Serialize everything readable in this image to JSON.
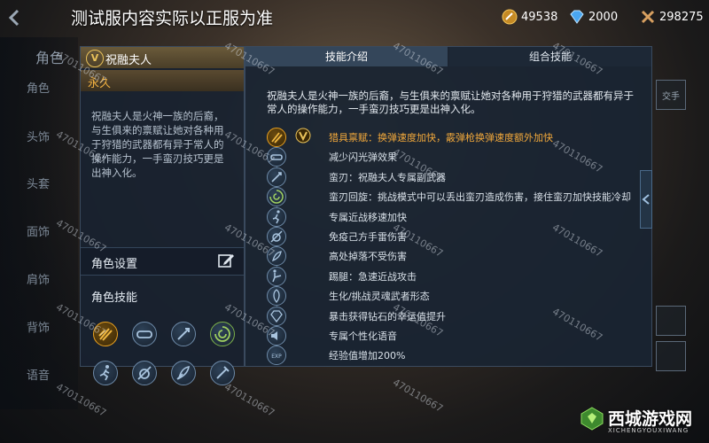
{
  "header": {
    "back_icon": "chevron-left-icon",
    "title": "测试服内容实际以正服为准",
    "currencies": [
      {
        "icon": "gold-coin-icon",
        "value": "49538",
        "color": "#e8a43a"
      },
      {
        "icon": "diamond-icon",
        "value": "2000",
        "color": "#5fb8ff"
      },
      {
        "icon": "medal-icon",
        "value": "298275",
        "color": "#d8a060"
      }
    ]
  },
  "sidebar": {
    "items": [
      "角色",
      "角色",
      "头饰",
      "头套",
      "面饰",
      "肩饰",
      "背饰",
      "语音"
    ]
  },
  "hero": {
    "badge": "V",
    "name": "祝融夫人",
    "duration": "永久",
    "description": "祝融夫人是火神一族的后裔，与生俱来的禀赋让她对各种用于狩猎的武器都有异于常人的操作能力，一手蛮刃技巧更是出神入化。",
    "settings_label": "角色设置",
    "skills_label": "角色技能",
    "mini_icons": [
      "dual-blade-icon",
      "goggles-icon",
      "sword-icon",
      "swirl-icon",
      "running-icon",
      "no-grenade-icon",
      "feather-icon",
      "knife-icon"
    ]
  },
  "panel": {
    "tabs": [
      "技能介绍",
      "组合技能"
    ],
    "description": "祝融夫人是火神一族的后裔，与生俱来的禀赋让她对各种用于狩猎的武器都有异于常人的操作能力，一手蛮刃技巧更是出神入化。",
    "skills": [
      {
        "icon": "dual-blade-icon",
        "text": "猎具禀赋：换弹速度加快，霰弹枪换弹速度额外加快",
        "highlight": true
      },
      {
        "icon": "goggles-icon",
        "text": "减少闪光弹效果",
        "highlight": false
      },
      {
        "icon": "sword-icon",
        "text": "蛮刃：祝融夫人专属副武器",
        "highlight": false
      },
      {
        "icon": "swirl-icon",
        "text": "蛮刃回旋：挑战模式中可以丢出蛮刃造成伤害，接住蛮刃加快技能冷却",
        "highlight": false
      },
      {
        "icon": "running-icon",
        "text": "专属近战移速加快",
        "highlight": false
      },
      {
        "icon": "no-grenade-icon",
        "text": "免疫己方手雷伤害",
        "highlight": false
      },
      {
        "icon": "feather-icon",
        "text": "高处掉落不受伤害",
        "highlight": false
      },
      {
        "icon": "kick-icon",
        "text": "踢腿：急速近战攻击",
        "highlight": false
      },
      {
        "icon": "soul-icon",
        "text": "生化/挑战灵魂武者形态",
        "highlight": false
      },
      {
        "icon": "diamond-luck-icon",
        "text": "暴击获得钻石的幸运值提升",
        "highlight": false
      },
      {
        "icon": "voice-icon",
        "text": "专属个性化语音",
        "highlight": false
      },
      {
        "icon": "exp-icon",
        "text": "经验值增加200%",
        "highlight": false
      }
    ]
  },
  "right_edge": {
    "label": "交手"
  },
  "watermark": "470110667",
  "logo": {
    "text": "西城游戏网",
    "sub": "XICHENGYOUXIWANG"
  }
}
